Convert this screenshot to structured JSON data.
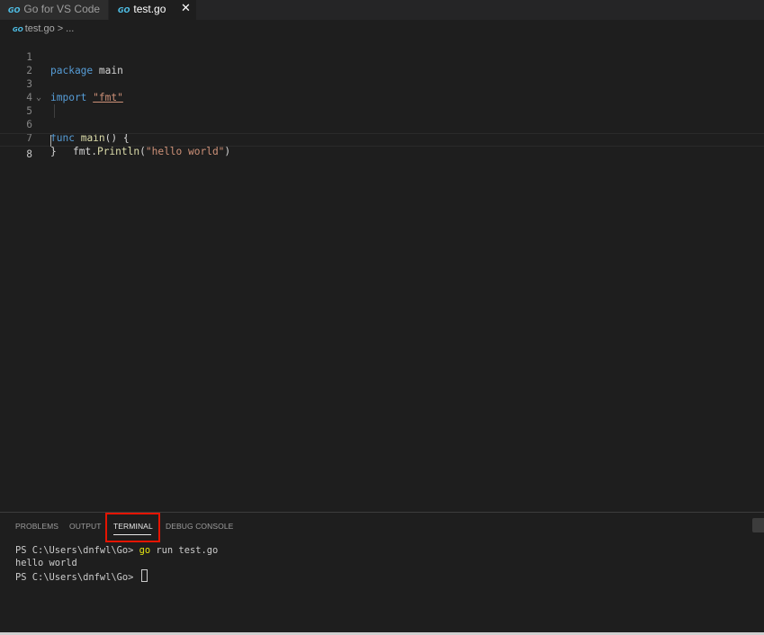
{
  "tabs": [
    {
      "label": "Go for VS Code",
      "icon": "go-logo-icon",
      "active": false
    },
    {
      "label": "test.go",
      "icon": "go-file-icon",
      "active": true,
      "close": "✕"
    }
  ],
  "go_glyph": "GO",
  "breadcrumb": {
    "file": "test.go",
    "separator": ">",
    "rest": "..."
  },
  "editor": {
    "lines": [
      {
        "n": "1"
      },
      {
        "n": "2"
      },
      {
        "n": "3"
      },
      {
        "n": "4"
      },
      {
        "n": "5"
      },
      {
        "n": "6"
      },
      {
        "n": "7"
      },
      {
        "n": "8"
      }
    ],
    "code": {
      "l1_kw": "package",
      "l1_rest": " main",
      "l3_kw": "import",
      "l3_str": "\"fmt\"",
      "l5_kw": "func",
      "l5_fn": "main",
      "l5_rest": "() {",
      "l6_pre": "fmt.",
      "l6_fn": "Println",
      "l6_open": "(",
      "l6_str": "\"hello world\"",
      "l6_close": ")",
      "l7": "}"
    }
  },
  "panel": {
    "tabs": [
      "PROBLEMS",
      "OUTPUT",
      "TERMINAL",
      "DEBUG CONSOLE"
    ],
    "active_tab": "TERMINAL",
    "terminal": {
      "line1_prompt": "PS C:\\Users\\dnfwl\\Go>",
      "line1_cmd_go": "go",
      "line1_cmd_rest": " run test.go",
      "line2": "hello world",
      "line3_prompt": "PS C:\\Users\\dnfwl\\Go>"
    }
  },
  "colors": {
    "keyword": "#569cd6",
    "function": "#dcdcaa",
    "string": "#ce9178",
    "highlight_box": "#e51400",
    "go_icon": "#4fc1e9"
  }
}
